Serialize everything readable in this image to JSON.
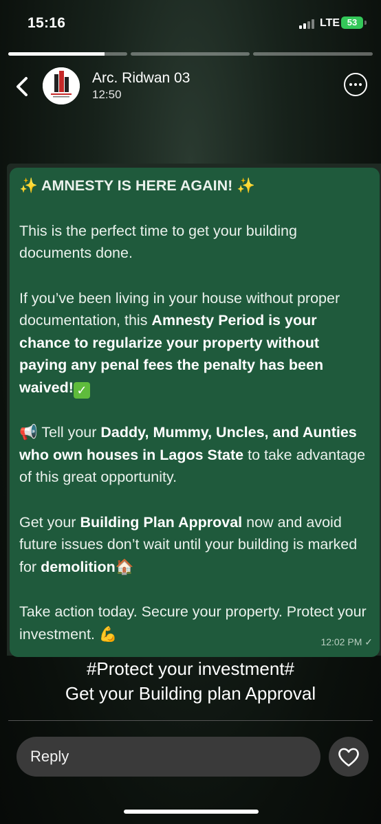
{
  "status_bar": {
    "time": "15:16",
    "network": "LTE",
    "battery": "53"
  },
  "story_progress": [
    {
      "fill": 0.81
    },
    {
      "fill": 0
    },
    {
      "fill": 0
    }
  ],
  "header": {
    "name": "Arc. Ridwan 03",
    "time": "12:50",
    "avatar_icon": "company-logo"
  },
  "message": {
    "title": "AMNESTY IS HERE AGAIN!",
    "p1": "This is the perfect time to get your building documents done.",
    "p2a": "If you’ve been living in your house without proper documentation, this ",
    "p2b": "Amnesty Period is your chance to regularize your property without paying any penal fees the penalty has been waived!",
    "p3a": " Tell your ",
    "p3b": "Daddy, Mummy, Uncles, and Aunties who own houses in Lagos State",
    "p3c": " to take advantage of this great opportunity.",
    "p4a": "Get your ",
    "p4b": "Building Plan Approval",
    "p4c": " now and avoid future issues don’t wait until your building is marked for ",
    "p4d": "demolition",
    "p5": "Take action today. Secure your property. Protect your investment.",
    "timestamp": "12:02 PM"
  },
  "caption": {
    "line1": "#Protect your investment#",
    "line2": "Get your Building plan Approval"
  },
  "reply": {
    "placeholder": "Reply"
  },
  "colors": {
    "bubble": "#1f5a3c",
    "battery": "#34c759",
    "input": "#3a3a3a"
  }
}
